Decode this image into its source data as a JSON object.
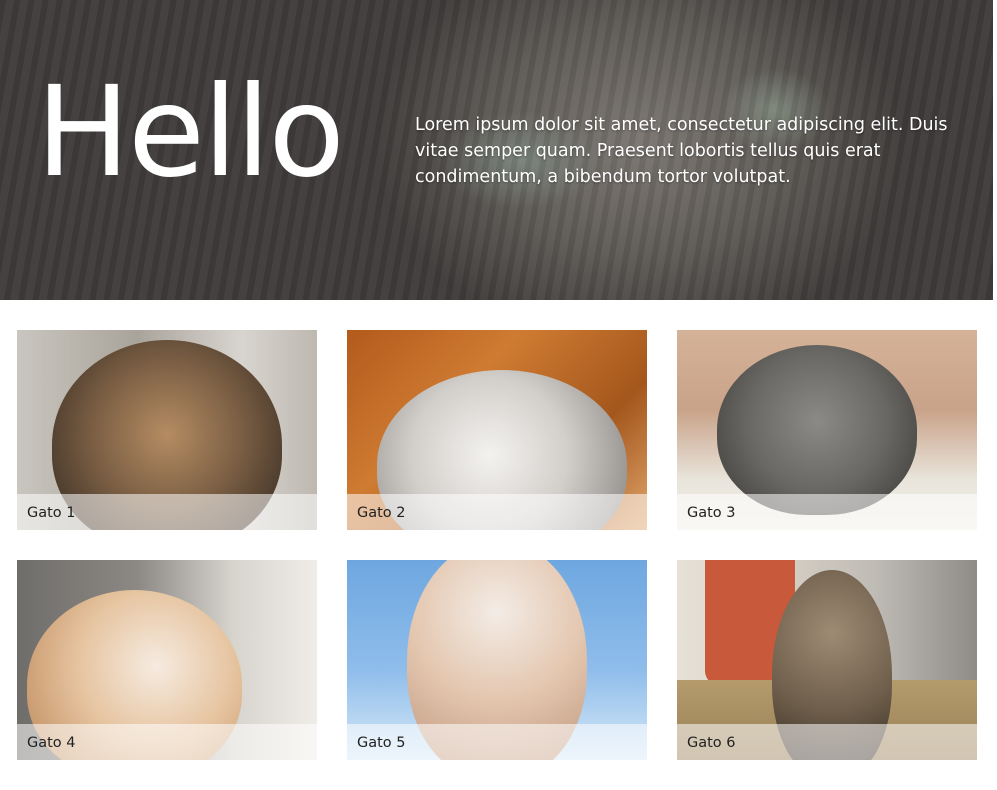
{
  "hero": {
    "title": "Hello",
    "text": "Lorem ipsum dolor sit amet, consectetur adipiscing elit. Duis vitae semper quam. Praesent lobortis tellus quis erat condimentum, a bibendum tortor volutpat."
  },
  "gallery": {
    "items": [
      {
        "label": "Gato 1"
      },
      {
        "label": "Gato 2"
      },
      {
        "label": "Gato 3"
      },
      {
        "label": "Gato 4"
      },
      {
        "label": "Gato 5"
      },
      {
        "label": "Gato 6"
      }
    ]
  }
}
